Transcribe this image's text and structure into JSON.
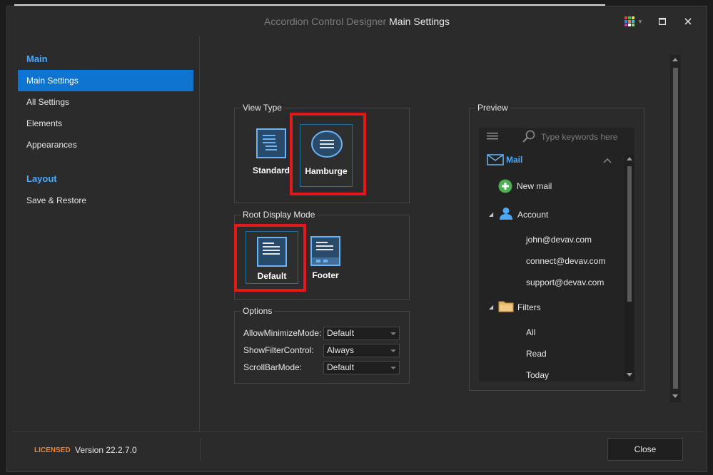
{
  "window": {
    "title_prefix": "Accordion Control Designer",
    "title_main": "Main Settings",
    "palette_colors": [
      "#e04040",
      "#40c040",
      "#e0e040",
      "#4080e0",
      "#e08040",
      "#40c0e0",
      "#c040c0",
      "#ffffff",
      "#80e080"
    ]
  },
  "sidebar": {
    "groups": [
      {
        "header": "Main",
        "items": [
          "Main Settings",
          "All Settings",
          "Elements",
          "Appearances"
        ]
      },
      {
        "header": "Layout",
        "items": [
          "Save & Restore"
        ]
      }
    ],
    "active_item": "Main Settings"
  },
  "view_type": {
    "title": "View Type",
    "options": [
      {
        "label": "Standard",
        "icon": "standard-view-icon"
      },
      {
        "label": "Hamburge",
        "icon": "hamburger-view-icon"
      }
    ],
    "selected": "Hamburge"
  },
  "root_display_mode": {
    "title": "Root Display Mode",
    "options": [
      {
        "label": "Default",
        "icon": "default-mode-icon"
      },
      {
        "label": "Footer",
        "icon": "footer-mode-icon"
      }
    ],
    "selected": "Default"
  },
  "options": {
    "title": "Options",
    "rows": [
      {
        "label": "AllowMinimizeMode:",
        "value": "Default"
      },
      {
        "label": "ShowFilterControl:",
        "value": "Always"
      },
      {
        "label": "ScrollBarMode:",
        "value": "Default"
      }
    ]
  },
  "preview": {
    "title": "Preview",
    "search_placeholder": "Type keywords here",
    "mail": {
      "label": "Mail",
      "children": [
        "New mail"
      ]
    },
    "account": {
      "label": "Account",
      "children": [
        "john@devav.com",
        "connect@devav.com",
        "support@devav.com"
      ]
    },
    "filters": {
      "label": "Filters",
      "children": [
        "All",
        "Read",
        "Today"
      ]
    }
  },
  "footer": {
    "licensed": "LICENSED",
    "version": "Version 22.2.7.0",
    "close_label": "Close"
  },
  "colors": {
    "accent": "#0f74d0",
    "group_header": "#4aa8ff",
    "highlight_red": "#e01a1a",
    "licensed": "#e8873a",
    "icon_blue": "#6ab4f5"
  }
}
